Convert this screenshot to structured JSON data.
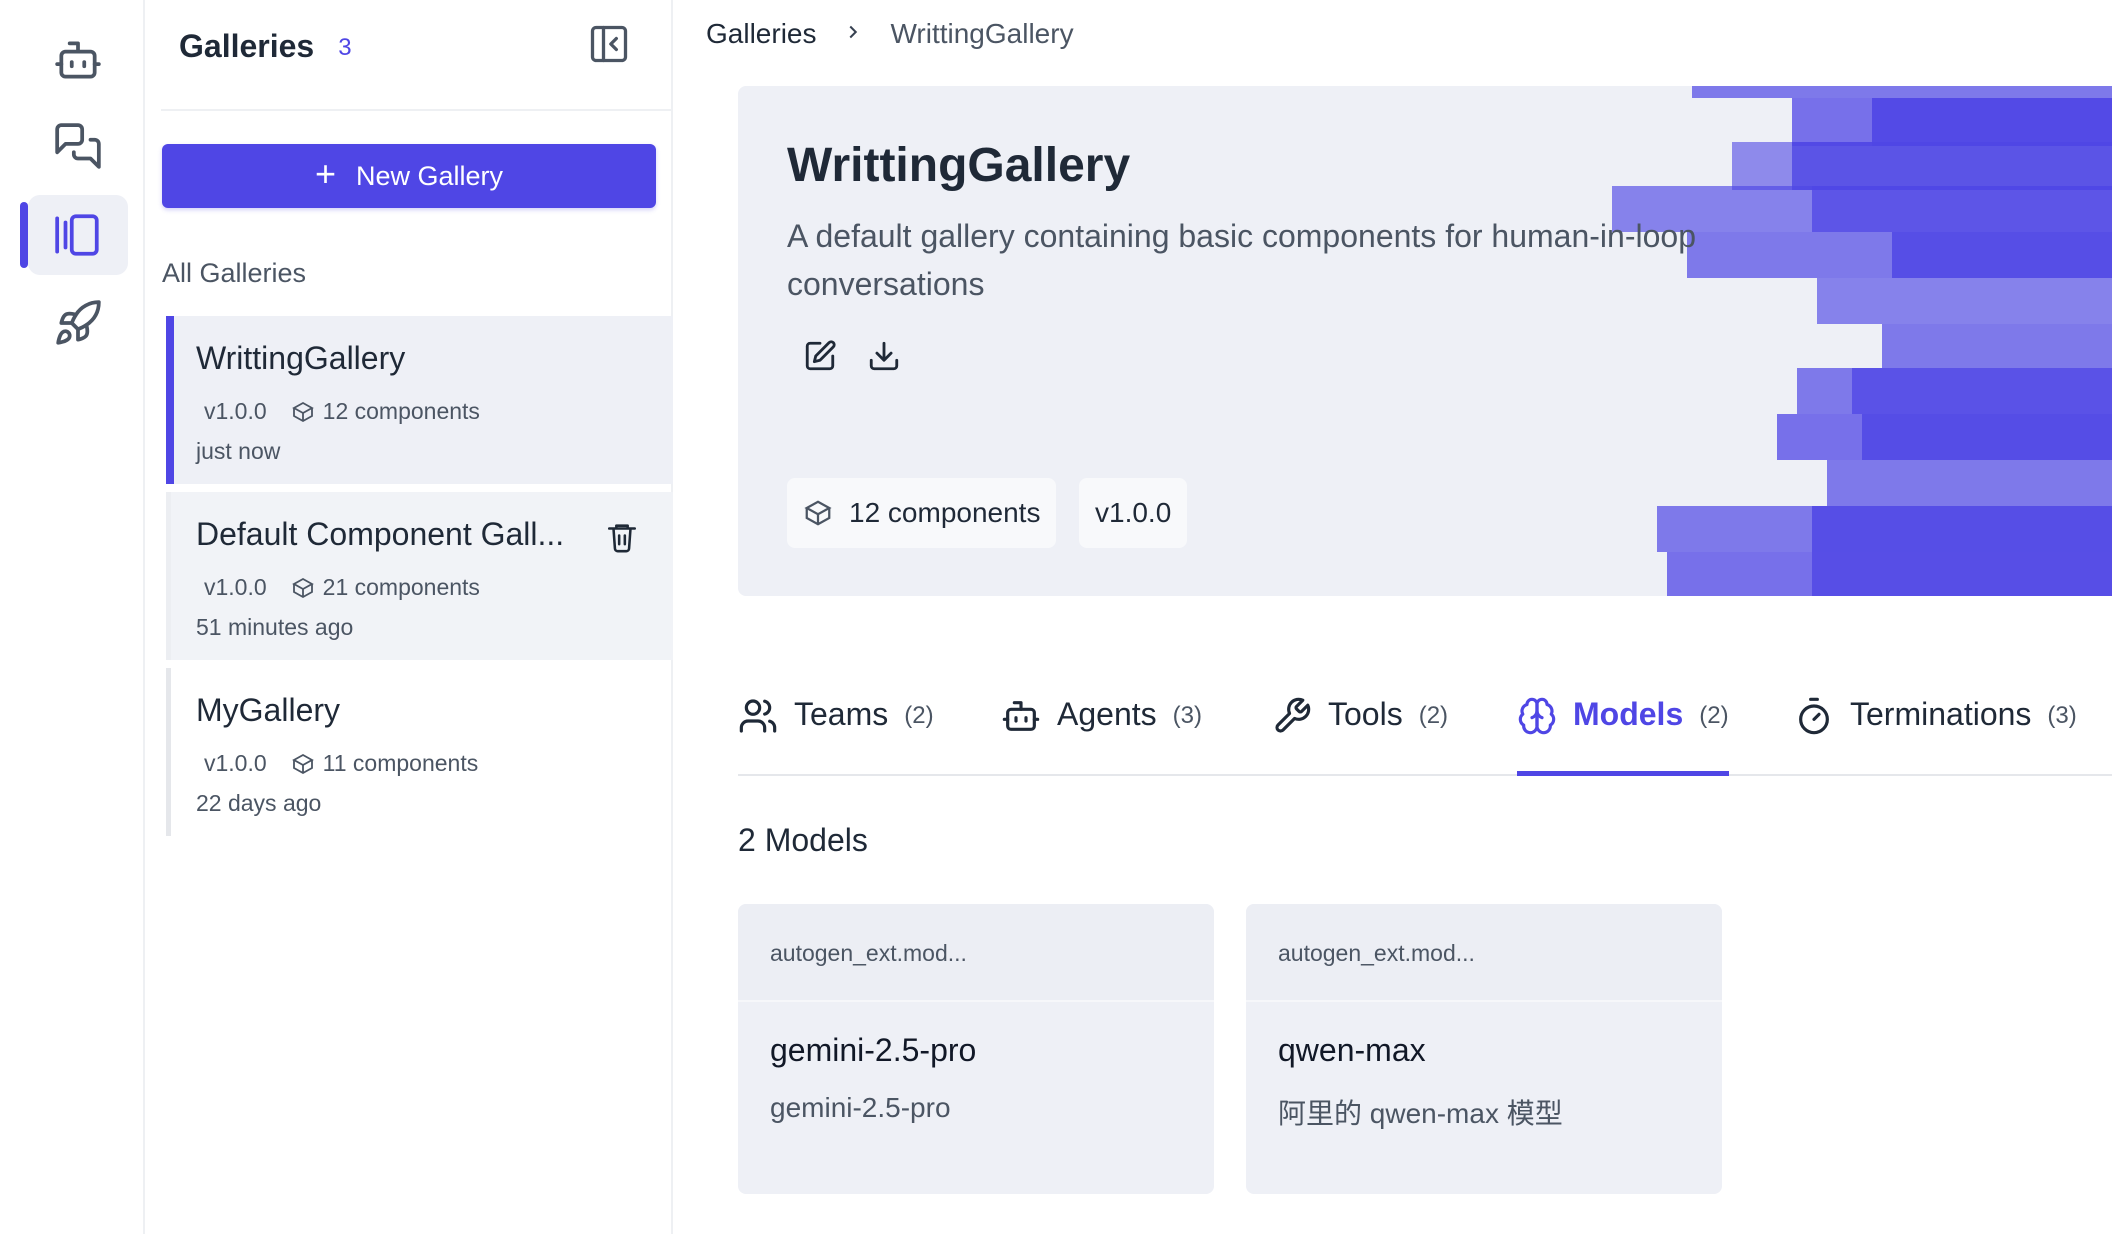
{
  "rail": {
    "items": [
      {
        "icon": "bot-icon"
      },
      {
        "icon": "chat-icon"
      },
      {
        "icon": "gallery-icon",
        "active": true
      },
      {
        "icon": "rocket-icon"
      }
    ]
  },
  "sidebar": {
    "title": "Galleries",
    "count": "3",
    "new_button_label": "New Gallery",
    "all_label": "All Galleries",
    "galleries": [
      {
        "name": "WrittingGallery",
        "version": "v1.0.0",
        "components": "12 components",
        "time": "just now"
      },
      {
        "name": "Default Component Gall...",
        "version": "v1.0.0",
        "components": "21 components",
        "time": "51 minutes ago"
      },
      {
        "name": "MyGallery",
        "version": "v1.0.0",
        "components": "11 components",
        "time": "22 days ago"
      }
    ]
  },
  "breadcrumb": {
    "root": "Galleries",
    "current": "WrittingGallery"
  },
  "hero": {
    "title": "WrittingGallery",
    "description": "A default gallery containing basic components for human-in-loop conversations",
    "components_chip": "12 components",
    "version_chip": "v1.0.0",
    "accent_color": "#4f46e5"
  },
  "tabs": [
    {
      "label": "Teams",
      "count": "(2)",
      "icon": "users-icon"
    },
    {
      "label": "Agents",
      "count": "(3)",
      "icon": "bot-icon"
    },
    {
      "label": "Tools",
      "count": "(2)",
      "icon": "wrench-icon"
    },
    {
      "label": "Models",
      "count": "(2)",
      "icon": "brain-icon",
      "active": true
    },
    {
      "label": "Terminations",
      "count": "(3)",
      "icon": "timer-icon"
    }
  ],
  "section_title": "2 Models",
  "models": [
    {
      "provider": "autogen_ext.mod...",
      "name": "gemini-2.5-pro",
      "description": "gemini-2.5-pro"
    },
    {
      "provider": "autogen_ext.mod...",
      "name": "qwen-max",
      "description": "阿里的 qwen-max 模型"
    }
  ]
}
